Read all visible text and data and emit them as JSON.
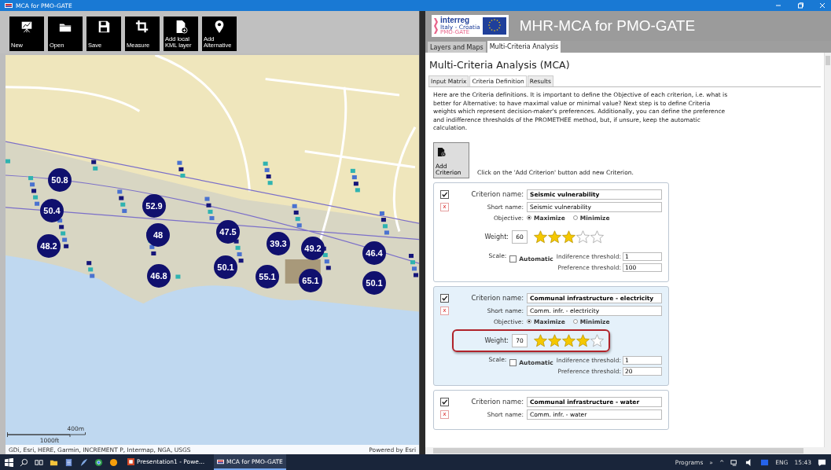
{
  "window": {
    "title": "MCA for PMO-GATE"
  },
  "toolbar": [
    {
      "label": "New"
    },
    {
      "label": "Open"
    },
    {
      "label": "Save"
    },
    {
      "label": "Measure"
    },
    {
      "label": "Add local KML layer"
    },
    {
      "label": "Add Alternative"
    }
  ],
  "map": {
    "markers": [
      "50.8",
      "50.4",
      "52.9",
      "48",
      "47.5",
      "39.3",
      "49.2",
      "46.4",
      "48.2",
      "46.8",
      "50.1",
      "55.1",
      "65.1",
      "50.1"
    ],
    "scale": {
      "metric": "400m",
      "imperial": "1000ft"
    },
    "attribution": "GDi, Esri, HERE, Garmin, INCREMENT P, Intermap, NGA, USGS",
    "powered_by": "Powered by Esri"
  },
  "header": {
    "logo_name": "interreg",
    "logo_region": "Italy - Croatia",
    "logo_project": "PMO-GATE",
    "title": "MHR-MCA for PMO-GATE"
  },
  "tabs": [
    {
      "label": "Layers and Maps",
      "selected": false
    },
    {
      "label": "Multi-Criteria Analysis",
      "selected": true
    }
  ],
  "panel_title": "Multi-Criteria Analysis (MCA)",
  "subtabs": [
    {
      "label": "Input Matrix",
      "selected": false
    },
    {
      "label": "Criteria Definition",
      "selected": true
    },
    {
      "label": "Results",
      "selected": false
    }
  ],
  "intro": "Here are the Criteria definitions. It is important to define the Objective of each criterion, i.e. what is better for Alternative: to have maximal value or minimal value? Next step is to define Criteria weights which represent decision-maker's preferences. Additionally, you can define the preference and indifference thresholds of the PROMETHEE method, but, if unsure, keep the automatic calculation.",
  "add_button": "Add Criterion",
  "add_hint": "Click on the 'Add Criterion' button add new Criterion.",
  "criteria": [
    {
      "checked": true,
      "selected": false,
      "name_label": "Criterion name:",
      "name": "Seismic vulnerability",
      "delete": "x",
      "short_label": "Short name:",
      "short_name": "Seismic vulnerability",
      "objective_label": "Objective:",
      "maximize_label": "Maximize",
      "minimize_label": "Minimize",
      "maximize": true,
      "weight_label": "Weight:",
      "weight": "60",
      "stars": 3,
      "weight_highlighted": false,
      "scale_label": "Scale:",
      "automatic_label": "Automatic",
      "automatic": false,
      "indifference_label": "Indiference threshold:",
      "indifference": "1",
      "preference_label": "Preference threshold:",
      "preference": "100"
    },
    {
      "checked": true,
      "selected": true,
      "name_label": "Criterion name:",
      "name": "Communal infrastructure - electricity",
      "delete": "x",
      "short_label": "Short name:",
      "short_name": "Comm. infr. - electricity",
      "objective_label": "Objective:",
      "maximize_label": "Maximize",
      "minimize_label": "Minimize",
      "maximize": true,
      "weight_label": "Weight:",
      "weight": "70",
      "stars": 4,
      "weight_highlighted": true,
      "scale_label": "Scale:",
      "automatic_label": "Automatic",
      "automatic": false,
      "indifference_label": "Indiference threshold:",
      "indifference": "1",
      "preference_label": "Preference threshold:",
      "preference": "20"
    },
    {
      "checked": true,
      "selected": false,
      "name_label": "Criterion name:",
      "name": "Communal infrastructure - water",
      "delete": "x",
      "short_label": "Short name:",
      "short_name": "Comm. infr. - water"
    }
  ],
  "taskbar": {
    "apps": [
      {
        "label": "Presentation1 - Powe...",
        "kind": "powerpoint",
        "selected": false
      },
      {
        "label": "MCA for PMO-GATE",
        "kind": "mca",
        "selected": true
      }
    ],
    "tray_label": "Programs",
    "tray_more": "»",
    "tray_up": "^",
    "language": "ENG",
    "time": "15:43"
  }
}
